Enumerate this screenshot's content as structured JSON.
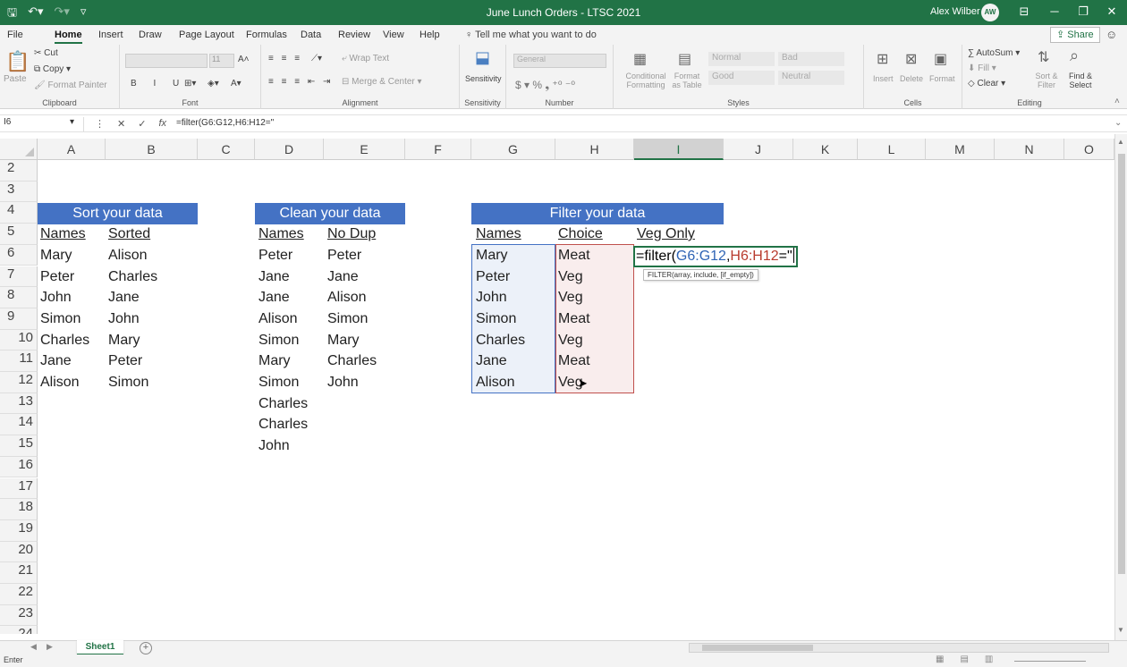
{
  "title_bar": {
    "title": "June Lunch Orders  -  LTSC 2021",
    "user": "Alex Wilber",
    "avatar": "AW"
  },
  "menu": {
    "tabs": [
      "File",
      "Home",
      "Insert",
      "Draw",
      "Page Layout",
      "Formulas",
      "Data",
      "Review",
      "View",
      "Help"
    ],
    "active": "Home",
    "tell_me": "Tell me what you want to do",
    "share": "Share"
  },
  "ribbon": {
    "clipboard": {
      "label": "Clipboard",
      "paste": "Paste",
      "cut": "Cut",
      "copy": "Copy",
      "format_painter": "Format Painter"
    },
    "font": {
      "label": "Font",
      "size": "11"
    },
    "alignment": {
      "label": "Alignment",
      "wrap_text": "Wrap Text",
      "merge_center": "Merge & Center"
    },
    "sensitivity": {
      "label": "Sensitivity",
      "button": "Sensitivity"
    },
    "number": {
      "label": "Number",
      "format": "General"
    },
    "styles": {
      "label": "Styles",
      "conditional": "Conditional Formatting",
      "format_table": "Format as Table",
      "normal": "Normal",
      "bad": "Bad",
      "good": "Good",
      "neutral": "Neutral"
    },
    "cells": {
      "label": "Cells",
      "insert": "Insert",
      "delete": "Delete",
      "format": "Format"
    },
    "editing": {
      "label": "Editing",
      "autosum": "AutoSum",
      "fill": "Fill",
      "clear": "Clear",
      "sort_filter": "Sort & Filter",
      "find_select": "Find & Select"
    }
  },
  "formula_bar": {
    "name_box": "I6",
    "formula": "=filter(G6:G12,H6:H12=\""
  },
  "columns": [
    "A",
    "B",
    "C",
    "D",
    "E",
    "F",
    "G",
    "H",
    "I",
    "J",
    "K",
    "L",
    "M",
    "N",
    "O"
  ],
  "selected_column": "I",
  "rows": [
    "2",
    "3",
    "4",
    "5",
    "6",
    "7",
    "8",
    "9",
    "10",
    "11",
    "12",
    "13",
    "14",
    "15",
    "16",
    "17",
    "18",
    "19",
    "20",
    "21",
    "22",
    "23",
    "24"
  ],
  "sort": {
    "banner": "Sort your data",
    "headers": [
      "Names",
      "Sorted"
    ],
    "names": [
      "Mary",
      "Peter",
      "John",
      "Simon",
      "Charles",
      "Jane",
      "Alison"
    ],
    "sorted": [
      "Alison",
      "Charles",
      "Jane",
      "John",
      "Mary",
      "Peter",
      "Simon"
    ]
  },
  "clean": {
    "banner": "Clean your data",
    "headers": [
      "Names",
      "No Dup"
    ],
    "names": [
      "Peter",
      "Jane",
      "Jane",
      "Alison",
      "Simon",
      "Mary",
      "Simon",
      "Charles",
      "Charles",
      "John"
    ],
    "nodup": [
      "Peter",
      "Jane",
      "Alison",
      "Simon",
      "Mary",
      "Charles",
      "John"
    ]
  },
  "filter": {
    "banner": "Filter your data",
    "headers": [
      "Names",
      "Choice",
      "Veg Only"
    ],
    "names": [
      "Mary",
      "Peter",
      "John",
      "Simon",
      "Charles",
      "Jane",
      "Alison"
    ],
    "choice": [
      "Meat",
      "Veg",
      "Veg",
      "Meat",
      "Veg",
      "Meat",
      "Veg"
    ],
    "editing": {
      "prefix": "=filter(",
      "ref1": "G6:G12",
      "comma": ",",
      "ref2": "H6:H12",
      "suffix": "=\""
    },
    "tooltip": "FILTER(array, include, [if_empty])"
  },
  "sheet_tabs": {
    "active": "Sheet1"
  },
  "status_bar": {
    "mode": "Enter"
  },
  "colors": {
    "excel_green": "#217346",
    "banner_blue": "#4472c4",
    "ref_red": "#c0504d"
  }
}
